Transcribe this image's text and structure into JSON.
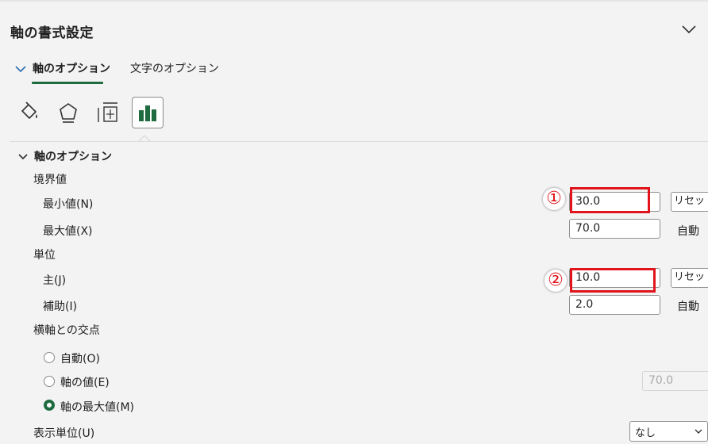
{
  "pane": {
    "title": "軸の書式設定"
  },
  "tabs": [
    {
      "label": "軸のオプション",
      "active": true
    },
    {
      "label": "文字のオプション",
      "active": false
    }
  ],
  "icons": [
    "fill-line-icon",
    "effects-pentagon-icon",
    "size-properties-icon",
    "axis-options-bar-chart-icon"
  ],
  "section": {
    "title": "軸のオプション",
    "bounds": {
      "label": "境界値",
      "min": {
        "label": "最小値(N)",
        "value": "30.0",
        "button": "リセット"
      },
      "max": {
        "label": "最大値(X)",
        "value": "70.0",
        "auto": "自動"
      }
    },
    "units": {
      "label": "単位",
      "major": {
        "label": "主(J)",
        "value": "10.0",
        "button": "リセット"
      },
      "minor": {
        "label": "補助(I)",
        "value": "2.0",
        "auto": "自動"
      }
    },
    "crosses": {
      "label": "横軸との交点",
      "options": [
        {
          "label": "自動(O)",
          "checked": false
        },
        {
          "label": "軸の値(E)",
          "checked": false,
          "value": "70.0"
        },
        {
          "label": "軸の最大値(M)",
          "checked": true
        }
      ]
    },
    "display_units": {
      "label": "表示単位(U)",
      "value": "なし"
    }
  },
  "annotations": [
    {
      "marker": "①"
    },
    {
      "marker": "②"
    }
  ],
  "colors": {
    "accent": "#1f6b3f",
    "highlight": "#e0141a"
  }
}
